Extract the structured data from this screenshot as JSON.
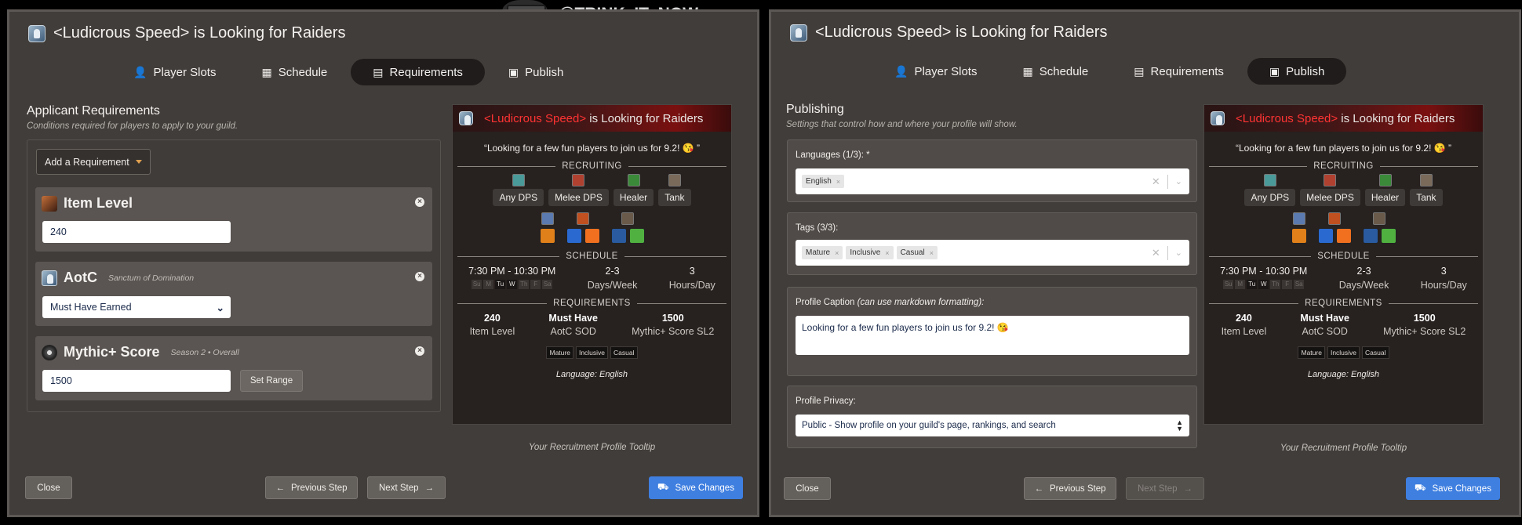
{
  "watermark": "@TRINK_IT_NOW",
  "title": "<Ludicrous Speed> is Looking for Raiders",
  "tabs": {
    "player_slots": "Player Slots",
    "schedule": "Schedule",
    "requirements": "Requirements",
    "publish": "Publish"
  },
  "left": {
    "section_title": "Applicant Requirements",
    "section_subtitle": "Conditions required for players to apply to your guild.",
    "add_requirement": "Add a Requirement",
    "requirements": [
      {
        "name": "Item Level",
        "sub": "",
        "value": "240"
      },
      {
        "name": "AotC",
        "sub": "Sanctum of Domination",
        "value": "Must Have Earned"
      },
      {
        "name": "Mythic+ Score",
        "sub": "Season 2 • Overall",
        "value": "1500",
        "extra_button": "Set Range"
      }
    ]
  },
  "right": {
    "section_title": "Publishing",
    "section_subtitle": "Settings that control how and where your profile will show.",
    "languages_label": "Languages (1/3): *",
    "languages": [
      "English"
    ],
    "tags_label": "Tags (3/3):",
    "tags": [
      "Mature",
      "Inclusive",
      "Casual"
    ],
    "caption_label": "Profile Caption",
    "caption_hint": "(can use markdown formatting):",
    "caption_value": "Looking for a few fun players to join us for 9.2! 😘",
    "privacy_label": "Profile Privacy:",
    "privacy_value": "Public - Show profile on your guild's page, rankings, and search"
  },
  "tooltip": {
    "guild": "<Ludicrous Speed>",
    "rest": "is Looking for Raiders",
    "quote": "“Looking for a few fun players to join us for 9.2! 😘 ”",
    "recruiting_heading": "RECRUITING",
    "roles": [
      "Any DPS",
      "Melee DPS",
      "Healer",
      "Tank"
    ],
    "schedule_heading": "SCHEDULE",
    "time": "7:30 PM - 10:30 PM",
    "days": [
      "Su",
      "M",
      "Tu",
      "W",
      "Th",
      "F",
      "Sa"
    ],
    "days_active": [
      false,
      false,
      true,
      true,
      false,
      false,
      false
    ],
    "days_per_week": "2-3",
    "days_per_week_label": "Days/Week",
    "hours_per_day": "3",
    "hours_per_day_label": "Hours/Day",
    "requirements_heading": "REQUIREMENTS",
    "req_items": [
      {
        "value": "240",
        "label": "Item Level"
      },
      {
        "value": "Must Have",
        "label": "AotC SOD"
      },
      {
        "value": "1500",
        "label": "Mythic+ Score SL2"
      }
    ],
    "tags": [
      "Mature",
      "Inclusive",
      "Casual"
    ],
    "language": "Language: English",
    "caption": "Your Recruitment Profile Tooltip"
  },
  "buttons": {
    "close": "Close",
    "previous": "Previous Step",
    "next": "Next Step",
    "save": "Save Changes"
  },
  "colors": {
    "accent": "#3f7fe0",
    "guild_red": "#ff3333",
    "panel": "#413d3a"
  }
}
